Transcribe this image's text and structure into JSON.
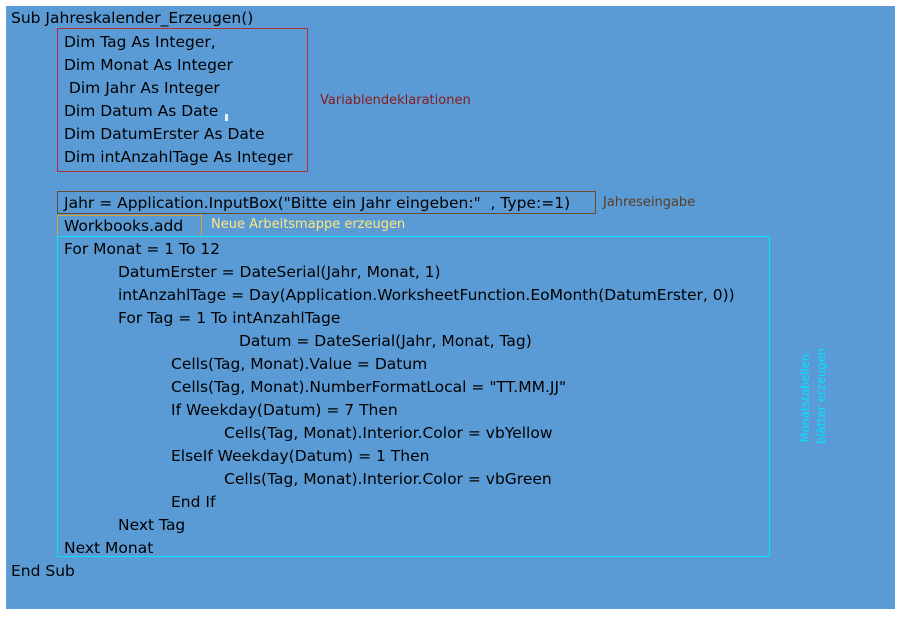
{
  "code": {
    "sub_start": "Sub Jahreskalender_Erzeugen()",
    "dim_tag": "Dim Tag As Integer,",
    "dim_monat": "Dim Monat As Integer",
    "dim_jahr": " Dim Jahr As Integer",
    "dim_datum": "Dim Datum As Date",
    "dim_datumerster": "Dim DatumErster As Date",
    "dim_anzahltage": "Dim intAnzahlTage As Integer",
    "jahr_input": "Jahr = Application.InputBox(\"Bitte ein Jahr eingeben:\"  , Type:=1)",
    "workbooks_add": "Workbooks.add",
    "for_monat": "For Monat = 1 To 12",
    "datumerster_assign": "DatumErster = DateSerial(Jahr, Monat, 1)",
    "anzahltage_assign": "intAnzahlTage = Day(Application.WorksheetFunction.EoMonth(DatumErster, 0))",
    "for_tag": "For Tag = 1 To intAnzahlTage",
    "datum_assign": "Datum = DateSerial(Jahr, Monat, Tag)",
    "cells_value": "Cells(Tag, Monat).Value = Datum",
    "cells_format": "Cells(Tag, Monat).NumberFormatLocal = \"TT.MM.JJ\"",
    "if_weekday": "If Weekday(Datum) = 7 Then",
    "color_yellow": "Cells(Tag, Monat).Interior.Color = vbYellow",
    "elseif_weekday": "ElseIf Weekday(Datum) = 1 Then",
    "color_green": "Cells(Tag, Monat).Interior.Color = vbGreen",
    "end_if": "End If",
    "next_tag": "Next Tag",
    "next_monat": "Next Monat",
    "end_sub": "End Sub"
  },
  "annotations": {
    "variables": "Variablendeklarationen",
    "year_input": "Jahreseingabe",
    "new_workbook": "Neue Arbeitsmappe erzeugen",
    "month_sheets_line1": "Monatstabellen-",
    "month_sheets_line2": "blätter erzeugen"
  },
  "colors": {
    "background": "#5b9bd5",
    "variables_box": "#b03040",
    "year_input_box": "#6b4a2e",
    "workbook_box": "#d9a53a",
    "loop_box": "#00e0ff"
  }
}
